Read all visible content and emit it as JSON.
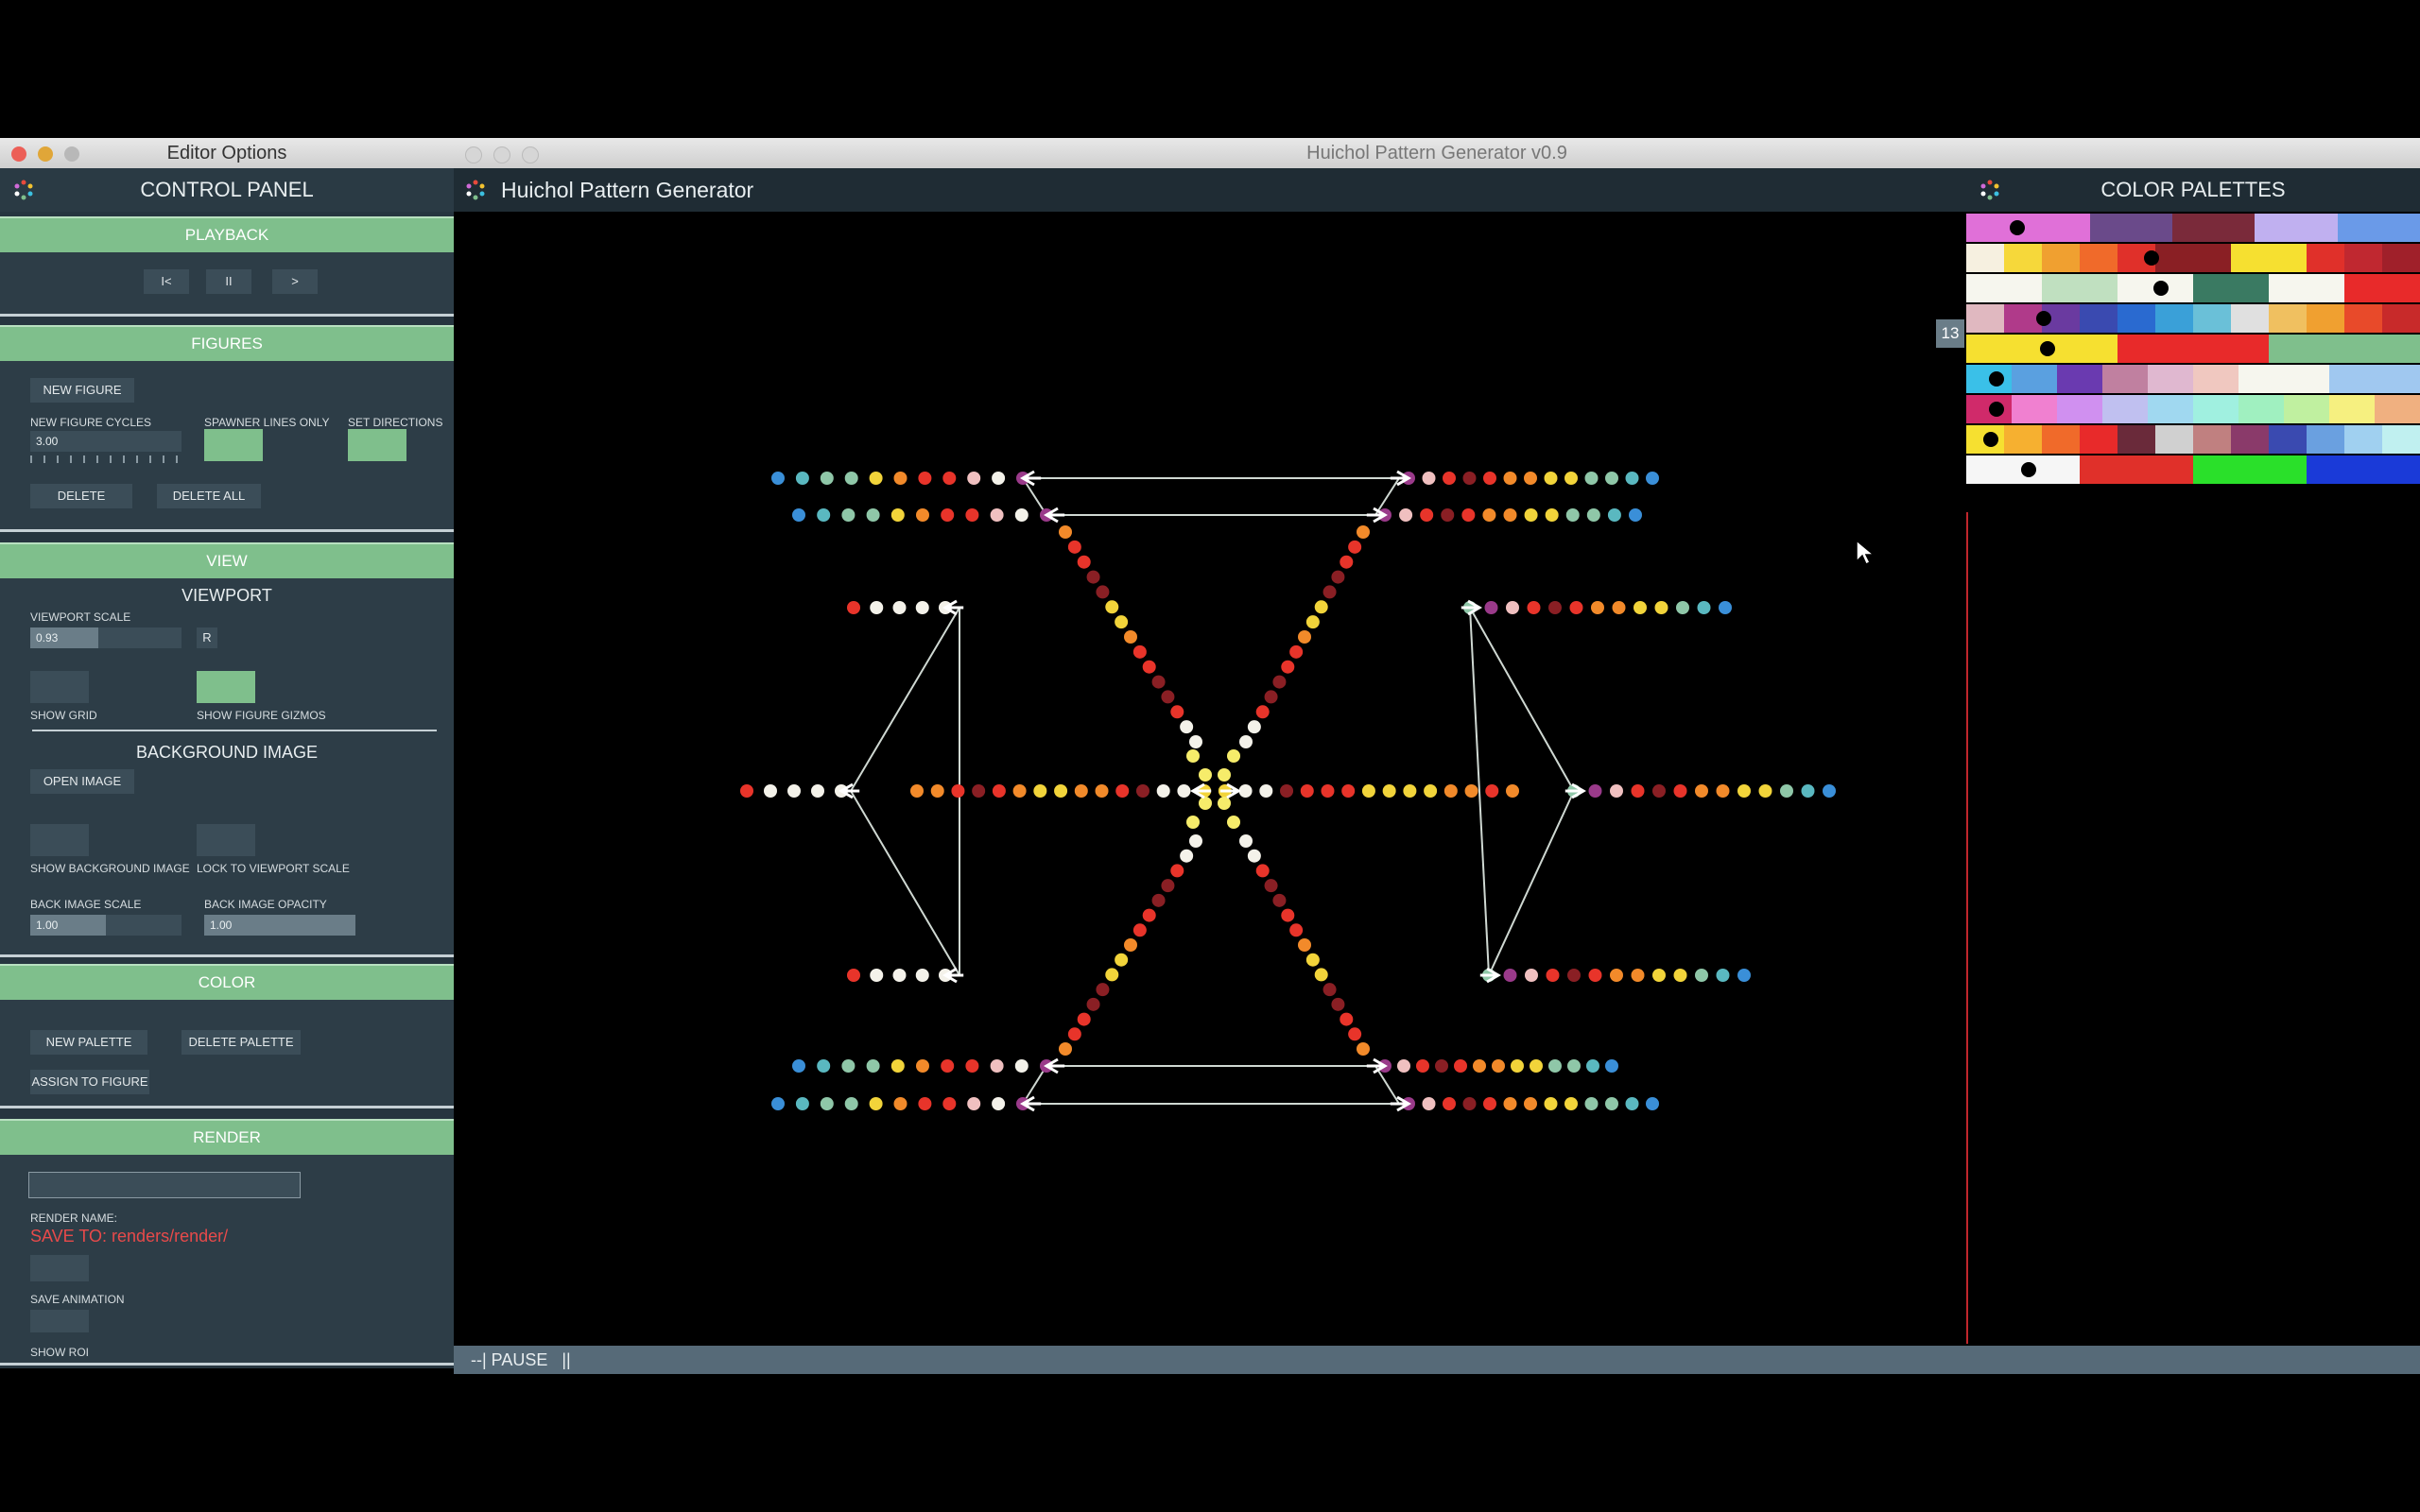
{
  "editor_window": {
    "title": "Editor Options"
  },
  "app_window": {
    "title": "Huichol Pattern Generator v0.9"
  },
  "control_panel": {
    "title": "CONTROL PANEL",
    "playback": {
      "header": "PLAYBACK",
      "first_label": "I<",
      "pause_label": "II",
      "next_label": ">"
    },
    "figures": {
      "header": "FIGURES",
      "new_figure": "NEW FIGURE",
      "cycles_label": "NEW FIGURE CYCLES",
      "cycles_value": "3.00",
      "spawner_label": "SPAWNER LINES ONLY",
      "directions_label": "SET DIRECTIONS",
      "delete": "DELETE",
      "delete_all": "DELETE ALL"
    },
    "view": {
      "header": "VIEW",
      "viewport_title": "VIEWPORT",
      "scale_label": "VIEWPORT SCALE",
      "scale_value": "0.93",
      "scale_fraction": 0.45,
      "reset_label": "R",
      "show_grid": "SHOW GRID",
      "show_gizmos": "SHOW FIGURE GIZMOS",
      "bg_title": "BACKGROUND IMAGE",
      "open_image": "OPEN IMAGE",
      "show_bg": "SHOW BACKGROUND IMAGE",
      "lock_scale": "LOCK TO VIEWPORT SCALE",
      "back_scale_label": "BACK IMAGE SCALE",
      "back_scale_value": "1.00",
      "back_scale_fraction": 0.5,
      "back_opacity_label": "BACK IMAGE OPACITY",
      "back_opacity_value": "1.00",
      "back_opacity_fraction": 1.0
    },
    "color": {
      "header": "COLOR",
      "new_palette": "NEW PALETTE",
      "delete_palette": "DELETE PALETTE",
      "assign": "ASSIGN TO FIGURE"
    },
    "render": {
      "header": "RENDER",
      "name_value": "",
      "name_label": "RENDER NAME:",
      "save_to": "SAVE TO: renders/render/",
      "save_animation": "SAVE ANIMATION",
      "show_roi": "SHOW ROI"
    }
  },
  "canvas": {
    "title": "Huichol Pattern Generator"
  },
  "status_bar": {
    "text": "--| PAUSE   ||"
  },
  "palettes": {
    "title": "COLOR PALETTES",
    "selected_index": "13",
    "colors": {
      "accent": "#7fbf8c",
      "panel": "#2d3d47",
      "cursor_line": "#c0262c"
    }
  }
}
